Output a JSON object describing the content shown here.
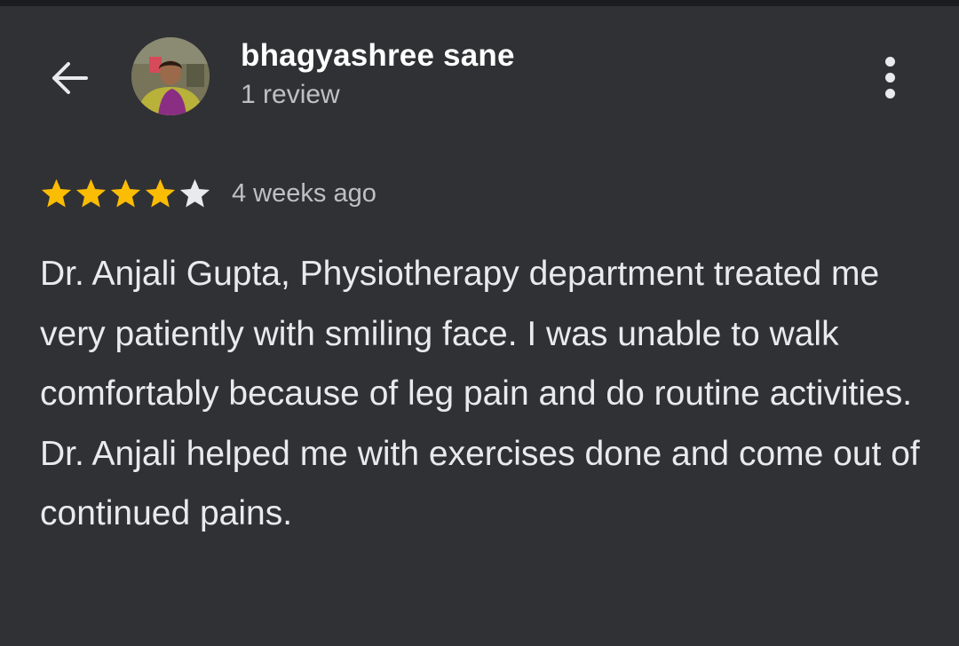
{
  "header": {
    "back_icon": "arrow-left-icon",
    "avatar_alt": "profile-photo",
    "reviewer_name": "bhagyashree sane",
    "review_count": "1 review",
    "more_icon": "more-vert-icon"
  },
  "review": {
    "rating": 4,
    "rating_max": 5,
    "time": "4 weeks ago",
    "text": "Dr. Anjali Gupta, Physiotherapy department treated me very patiently with smiling face. I was unable to walk comfortably because of leg pain and do routine activities. Dr. Anjali helped me with exercises done and come out of continued pains."
  },
  "colors": {
    "background": "#303134",
    "star_filled": "#fbbc04",
    "star_empty": "#e8eaed",
    "text_primary": "#e8eaed",
    "text_secondary": "#bdc1c6"
  }
}
